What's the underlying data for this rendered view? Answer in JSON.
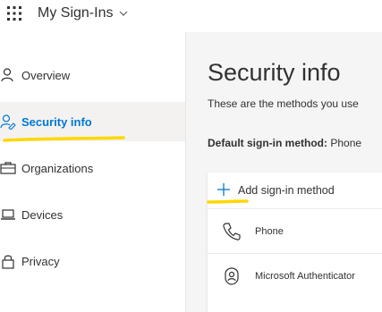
{
  "header": {
    "app_title": "My Sign-Ins",
    "waffle_icon": "waffle-icon",
    "chevron_icon": "chevron-down-icon"
  },
  "sidebar": {
    "items": [
      {
        "label": "Overview",
        "icon": "person-icon",
        "active": false
      },
      {
        "label": "Security info",
        "icon": "security-info-icon",
        "active": true
      },
      {
        "label": "Organizations",
        "icon": "briefcase-icon",
        "active": false
      },
      {
        "label": "Devices",
        "icon": "laptop-icon",
        "active": false
      },
      {
        "label": "Privacy",
        "icon": "lock-icon",
        "active": false
      }
    ]
  },
  "main": {
    "title": "Security info",
    "description": "These are the methods you use",
    "default_method_label": "Default sign-in method:",
    "default_method_value": "Phone",
    "add_method_label": "Add sign-in method",
    "methods": [
      {
        "label": "Phone",
        "icon": "phone-icon"
      },
      {
        "label": "Microsoft Authenticator",
        "icon": "authenticator-icon"
      }
    ]
  },
  "colors": {
    "accent": "#0078d4",
    "highlight": "#ffd800",
    "active_background": "#f3f2f1",
    "main_background": "#f5f5f5"
  }
}
